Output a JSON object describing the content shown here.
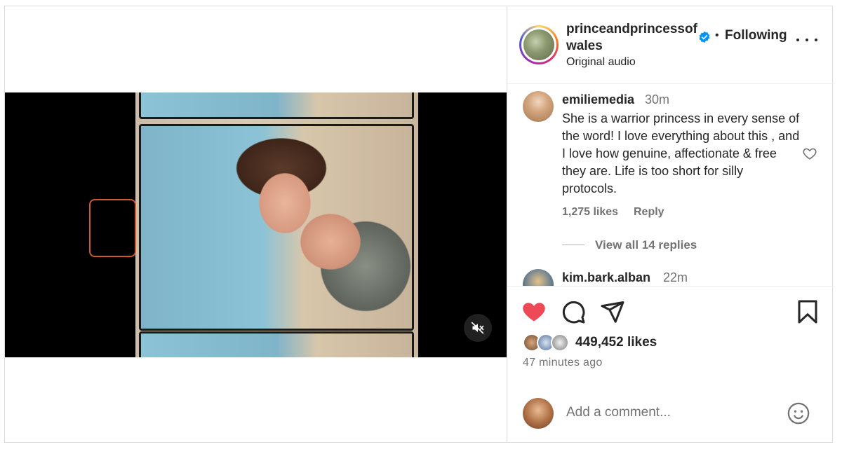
{
  "header": {
    "username": "princeandprincessofwales",
    "separator": "•",
    "follow_status": "Following",
    "audio": "Original audio"
  },
  "comments": [
    {
      "username": "emiliemedia",
      "time": "30m",
      "text": "She is a warrior princess in every sense of the word! I love everything about this , and I love how genuine, affectionate & free they are. Life is too short for silly protocols.",
      "likes": "1,275 likes",
      "reply_label": "Reply",
      "view_replies": "View all 14 replies"
    },
    {
      "username": "kim.bark.alban",
      "time": "22m"
    }
  ],
  "post": {
    "likes": "449,452 likes",
    "time_ago": "47 minutes ago"
  },
  "composer": {
    "placeholder": "Add a comment..."
  },
  "icons": {
    "verified": "verified-badge-icon",
    "more": "more-options-icon",
    "like": "heart-filled-icon",
    "comment": "comment-bubble-icon",
    "share": "send-paper-plane-icon",
    "save": "bookmark-icon",
    "mute": "speaker-muted-icon",
    "emoji": "smiley-icon"
  },
  "colors": {
    "like_red": "#ed4956",
    "verified_blue": "#0095f6",
    "secondary_text": "#737373",
    "primary_text": "#262626"
  }
}
